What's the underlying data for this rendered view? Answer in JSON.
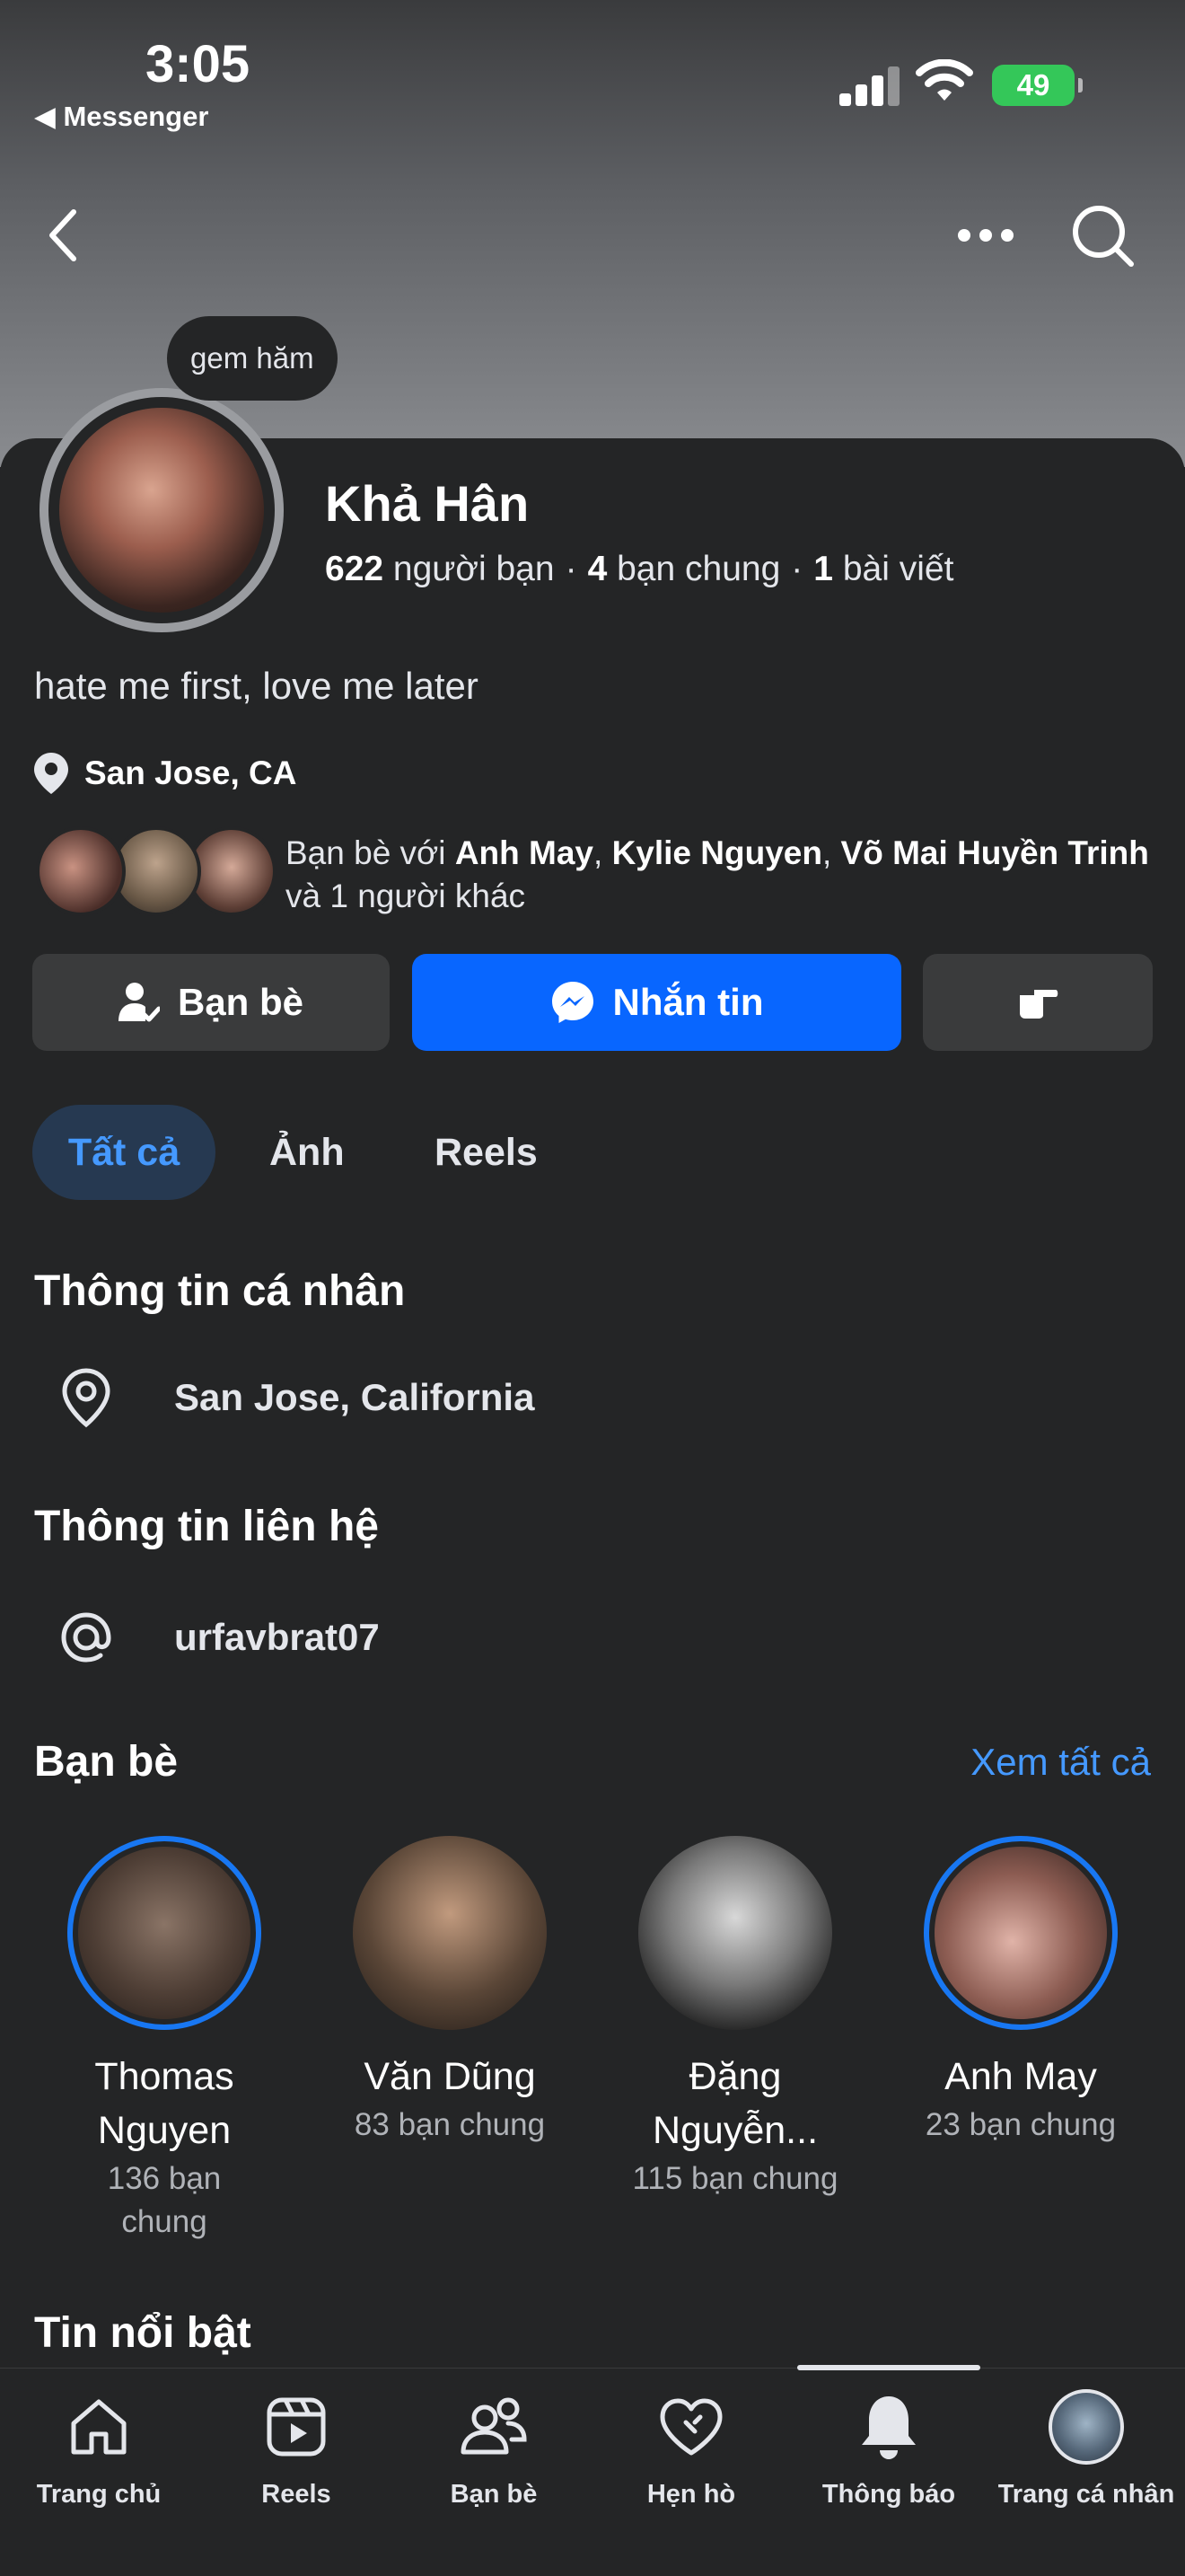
{
  "status_bar": {
    "time": "3:05",
    "back_app": "◀ Messenger",
    "battery": "49"
  },
  "profile": {
    "note": "gem hăm",
    "name": "Khả Hân",
    "friends_count": "622",
    "friends_label": "người bạn",
    "mutual_count": "4",
    "mutual_label": "bạn chung",
    "posts_count": "1",
    "posts_label": "bài viết",
    "bio": "hate me first, love me later",
    "location": "San Jose, CA",
    "mutual_prefix": "Bạn bè với",
    "mutual_names": "Anh May",
    "mutual_sep1": ",",
    "mutual_name2": "Kylie Nguyen",
    "mutual_sep2": ",",
    "mutual_name3": "Võ Mai Huyền Trinh",
    "mutual_suffix": "và 1 người khác"
  },
  "actions": {
    "friends": "Bạn bè",
    "message": "Nhắn tin"
  },
  "tabs": [
    {
      "label": "Tất cả"
    },
    {
      "label": "Ảnh"
    },
    {
      "label": "Reels"
    }
  ],
  "personal_info": {
    "title": "Thông tin cá nhân",
    "location": "San Jose, California"
  },
  "contact_info": {
    "title": "Thông tin liên hệ",
    "handle": "urfavbrat07"
  },
  "friends_section": {
    "title": "Bạn bè",
    "see_all": "Xem tất cả",
    "items": [
      {
        "name": "Thomas Nguyen",
        "mutual": "136 bạn chung"
      },
      {
        "name": "Văn Dũng",
        "mutual": "83 bạn chung"
      },
      {
        "name": "Đặng Nguyễn...",
        "mutual": "115 bạn chung"
      },
      {
        "name": "Anh May",
        "mutual": "23 bạn chung"
      }
    ]
  },
  "highlights": {
    "title": "Tin nổi bật"
  },
  "bottom_nav": [
    {
      "label": "Trang chủ",
      "icon": "home-icon"
    },
    {
      "label": "Reels",
      "icon": "reels-icon"
    },
    {
      "label": "Bạn bè",
      "icon": "friends-icon"
    },
    {
      "label": "Hẹn hò",
      "icon": "dating-icon"
    },
    {
      "label": "Thông báo",
      "icon": "bell-icon"
    },
    {
      "label": "Trang cá nhân",
      "icon": "profile-avatar"
    }
  ],
  "colors": {
    "accent": "#0866ff",
    "link": "#4599ff",
    "background": "#242526",
    "button": "#3a3b3c"
  }
}
